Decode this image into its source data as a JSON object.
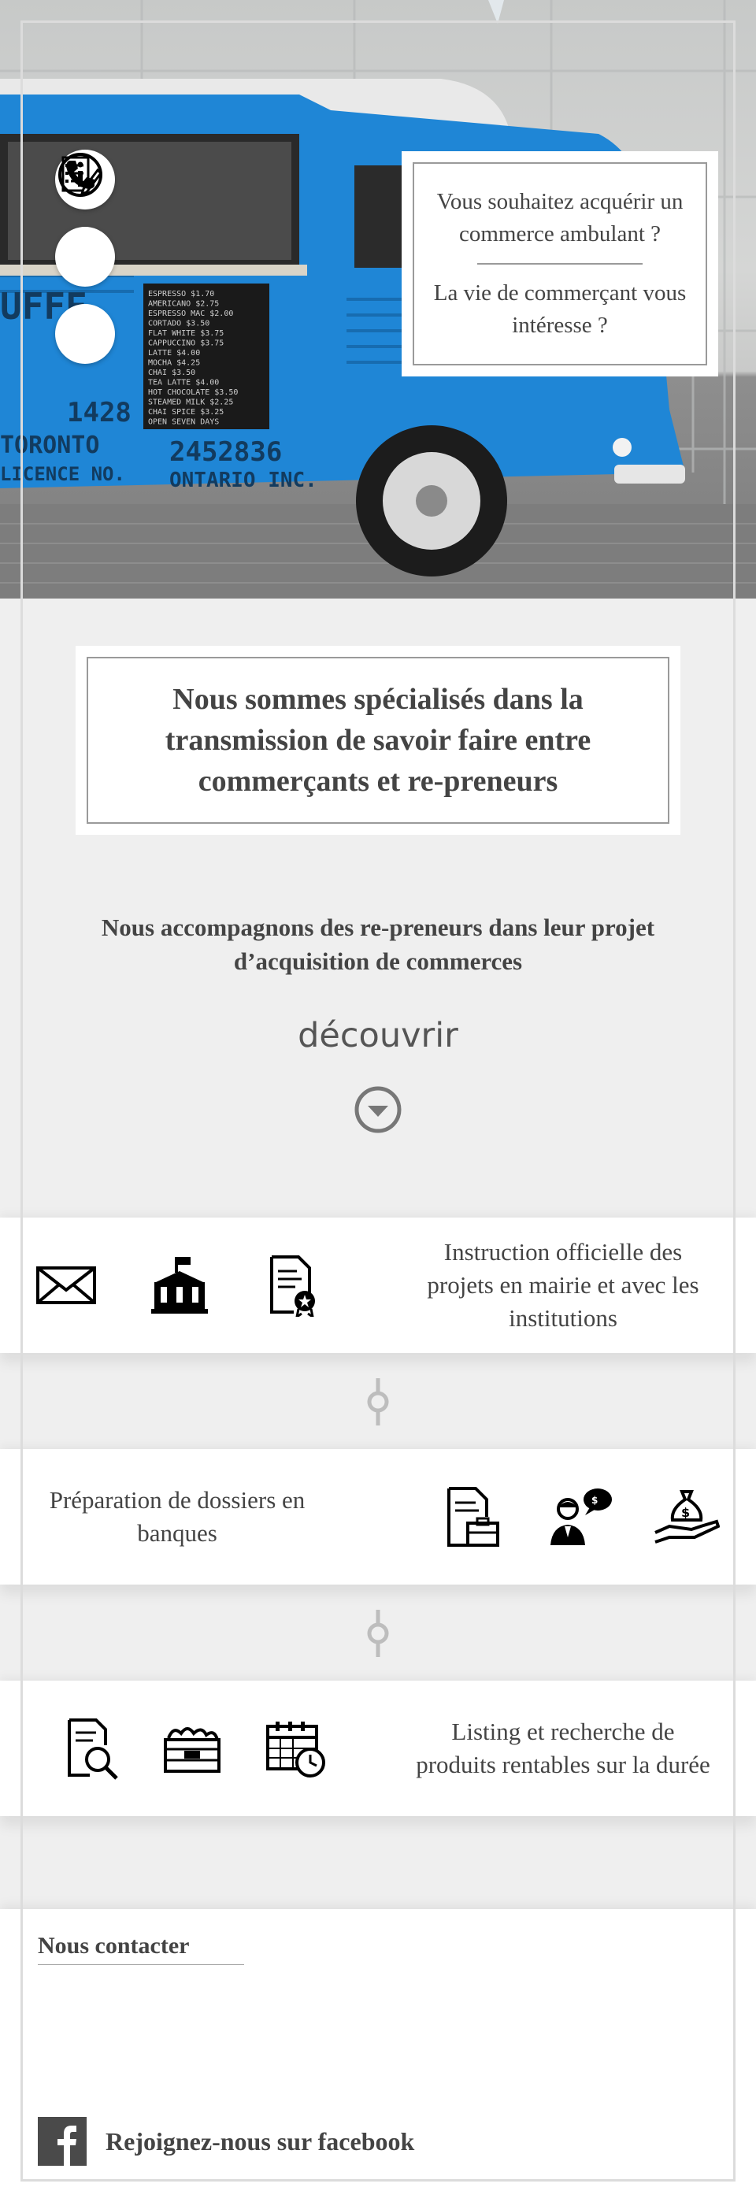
{
  "hero": {
    "card_line1": "Vous souhaitez acquérir un commerce ambulant ?",
    "card_line2": "La vie de commerçant vous intéresse ?",
    "truck_lettering": {
      "number": "2452836",
      "province": "ONTARIO INC.",
      "city": "TORONTO",
      "licence": "LICENCE NO.",
      "code": "1428",
      "brand": "UFFE"
    },
    "menu_board": [
      "ESPRESSO $1.70",
      "AMERICANO $2.75",
      "ESPRESSO MAC $2.00",
      "CORTADO $3.50",
      "FLAT WHITE $3.75",
      "CAPPUCCINO $3.75",
      "LATTE $4.00",
      "MOCHA $4.25",
      "CHAI $3.50",
      "TEA LATTE $4.00",
      "HOT CHOCOLATE $3.50",
      "STEAMED MILK $2.25",
      "CHAI SPICE $3.25",
      "OPEN SEVEN DAYS"
    ],
    "icons": [
      "info-icon",
      "checklist-icon",
      "phone-icon"
    ]
  },
  "intro": {
    "title": "Nous sommes spécialisés dans la transmission de savoir faire entre commerçants et re-preneurs",
    "lead": "Nous accompagnons des re-preneurs dans leur projet d’acquisition de commerces",
    "discover": "découvrir"
  },
  "services": [
    {
      "text": "Instruction officielle des projets en mairie et avec les institutions",
      "icons": [
        "envelope-icon",
        "town-hall-icon",
        "certificate-document-icon"
      ]
    },
    {
      "text": "Préparation de dossiers en banques",
      "icons": [
        "briefcase-document-icon",
        "banker-meeting-icon",
        "money-bag-hand-icon"
      ]
    },
    {
      "text": "Listing et recherche de produits rentables sur la durée",
      "icons": [
        "document-search-icon",
        "produce-crate-icon",
        "calendar-clock-icon"
      ]
    }
  ],
  "contact": {
    "title": "Nous contacter",
    "facebook": "Rejoignez-nous sur facebook"
  },
  "colors": {
    "background": "#efefef",
    "text": "#444444",
    "truck_blue": "#1f86d6",
    "border_grey": "#9a9a9a"
  }
}
